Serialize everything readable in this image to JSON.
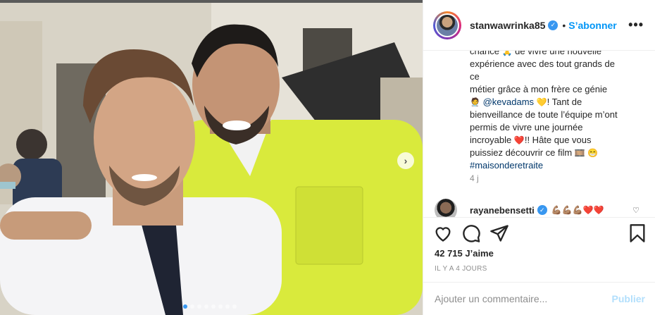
{
  "post": {
    "author": {
      "username": "stanwawrinka85",
      "verified": true,
      "follow_label": "S’abonner"
    },
    "more_label": "•••",
    "separator": "•",
    "caption": {
      "line1": "chance",
      "line1b": "de vivre une nouvelle",
      "line2": "expérience avec des tout grands de ce",
      "line3": "métier grâce à mon frère ce génie",
      "mention": "@kevadams",
      "line4b": "! Tant de",
      "line5": "bienveillance de toute l’équipe m’ont",
      "line6": "permis de vivre une journée",
      "line7": "incroyable",
      "line7b": "!! Hâte que vous",
      "line8": "puissiez découvrir ce film",
      "hashtag": "#maisonderetraite"
    },
    "caption_ago": "4 j",
    "comment": {
      "username": "rayanebensetti",
      "verified": true,
      "emojis": "💪🏽💪🏽💪🏽❤️❤️"
    },
    "likes": "42 715 J’aime",
    "time_ago": "IL Y A 4 JOURS",
    "add_comment_placeholder": "Ajouter un commentaire...",
    "publish_label": "Publier",
    "carousel": {
      "count": 8,
      "active": 1
    }
  },
  "icons": [
    "heart-icon",
    "comment-icon",
    "share-icon",
    "bookmark-icon",
    "chevron-right-icon"
  ],
  "colors": {
    "accent": "#0095f6",
    "verified": "#3897f0",
    "publish_disabled": "#b2dffc",
    "muted": "#8e8e8e"
  }
}
